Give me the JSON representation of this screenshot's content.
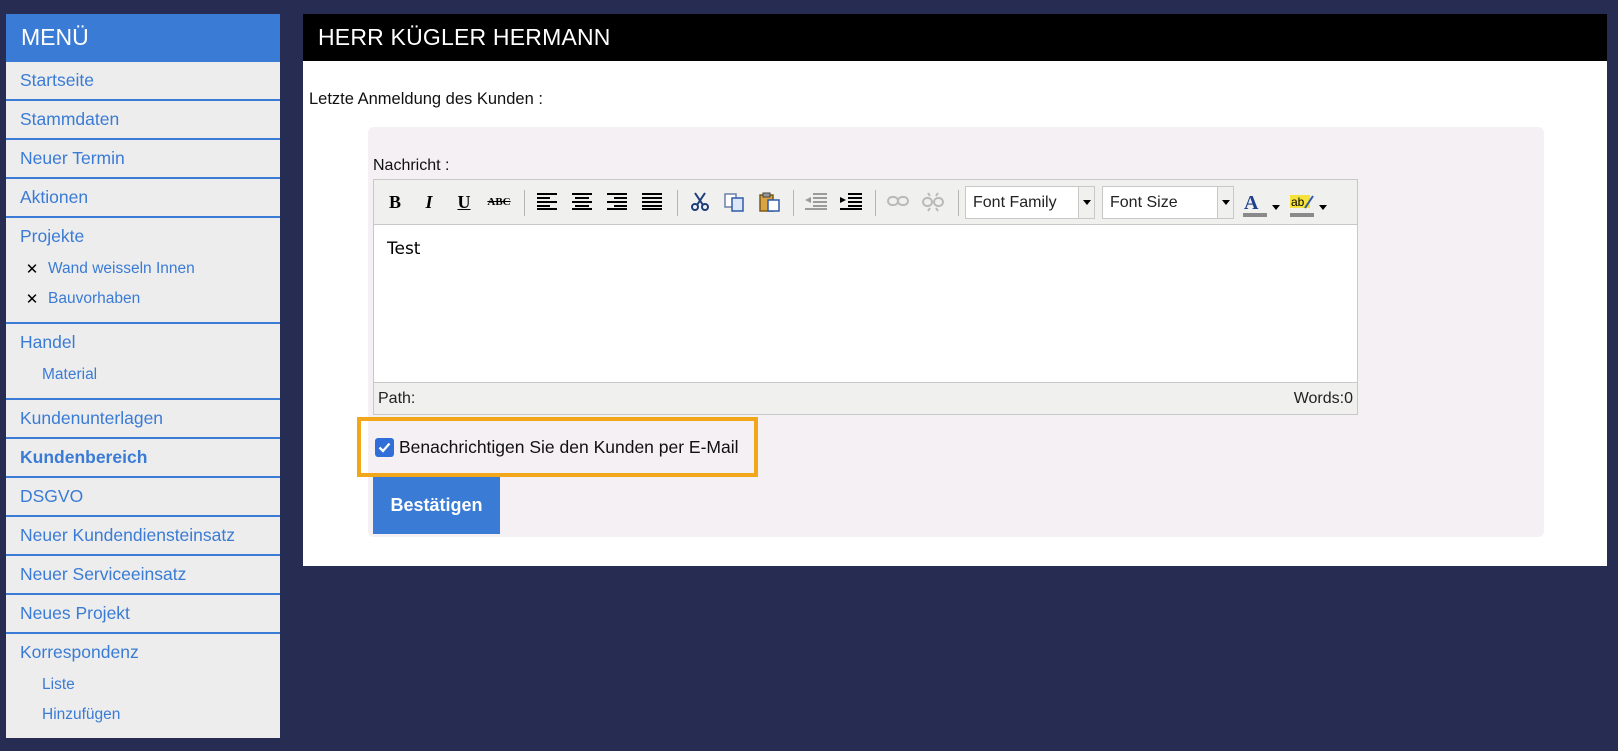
{
  "sidebar": {
    "title": "MENÜ",
    "items": [
      {
        "label": "Startseite"
      },
      {
        "label": "Stammdaten"
      },
      {
        "label": "Neuer Termin"
      },
      {
        "label": "Aktionen"
      },
      {
        "label": "Projekte",
        "children": [
          {
            "label": "Wand weisseln Innen"
          },
          {
            "label": "Bauvorhaben"
          }
        ]
      },
      {
        "label": "Handel",
        "children": [
          {
            "label": "Material"
          }
        ]
      },
      {
        "label": "Kundenunterlagen"
      },
      {
        "label": "Kundenbereich",
        "active": true
      },
      {
        "label": "DSGVO"
      },
      {
        "label": "Neuer Kundendiensteinsatz"
      },
      {
        "label": "Neuer Serviceeinsatz"
      },
      {
        "label": "Neues Projekt"
      },
      {
        "label": "Korrespondenz",
        "children": [
          {
            "label": "Liste"
          },
          {
            "label": "Hinzufügen"
          }
        ]
      }
    ]
  },
  "main": {
    "title": "HERR KÜGLER HERMANN",
    "last_login_label": "Letzte Anmeldung des Kunden :",
    "message_label": "Nachricht :",
    "editor": {
      "font_family_placeholder": "Font Family",
      "font_size_placeholder": "Font Size",
      "content": "Test",
      "path_label": "Path:",
      "words_label": "Words:0"
    },
    "notify": {
      "label": "Benachrichtigen Sie den Kunden per E-Mail",
      "checked": true
    },
    "submit_label": "Bestätigen"
  },
  "colors": {
    "background": "#272d52",
    "accent": "#3a7bd5",
    "highlight": "#f2a71b",
    "header": "#000000"
  }
}
